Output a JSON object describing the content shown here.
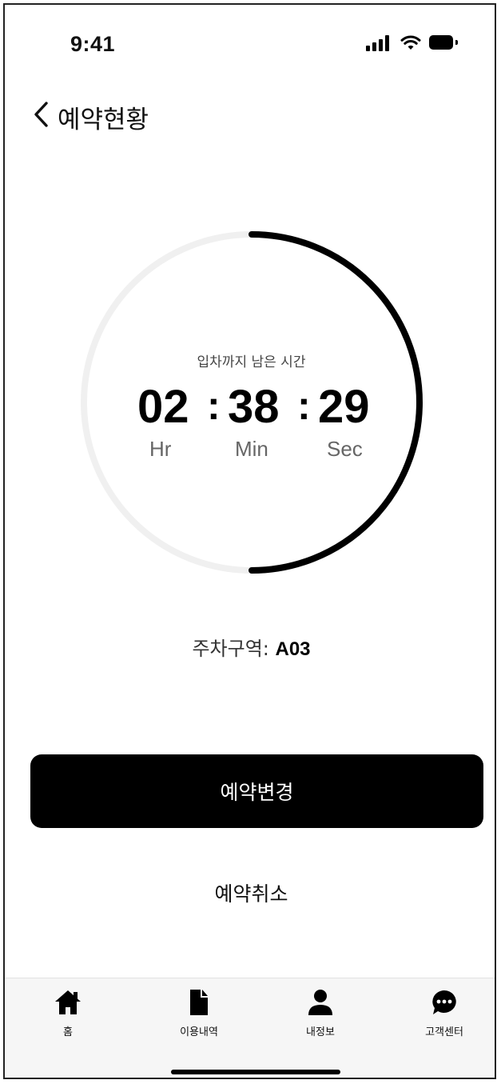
{
  "status_bar": {
    "time": "9:41"
  },
  "header": {
    "title": "예약현황"
  },
  "timer": {
    "caption": "입차까지 남은 시간",
    "hours": "02",
    "minutes": "38",
    "seconds": "29",
    "separator": ":",
    "units": {
      "hours": "Hr",
      "minutes": "Min",
      "seconds": "Sec"
    },
    "progress_fraction": 0.5
  },
  "parking": {
    "label": "주차구역: ",
    "zone": "A03"
  },
  "actions": {
    "change_label": "예약변경",
    "cancel_label": "예약취소"
  },
  "tabbar": {
    "items": [
      {
        "label": "홈",
        "icon": "home-icon"
      },
      {
        "label": "이용내역",
        "icon": "document-icon"
      },
      {
        "label": "내정보",
        "icon": "person-icon"
      },
      {
        "label": "고객센터",
        "icon": "chat-icon"
      }
    ]
  },
  "colors": {
    "accent": "#000000",
    "ring_track": "#f0f0f0",
    "tabbar_bg": "#f6f6f6"
  }
}
